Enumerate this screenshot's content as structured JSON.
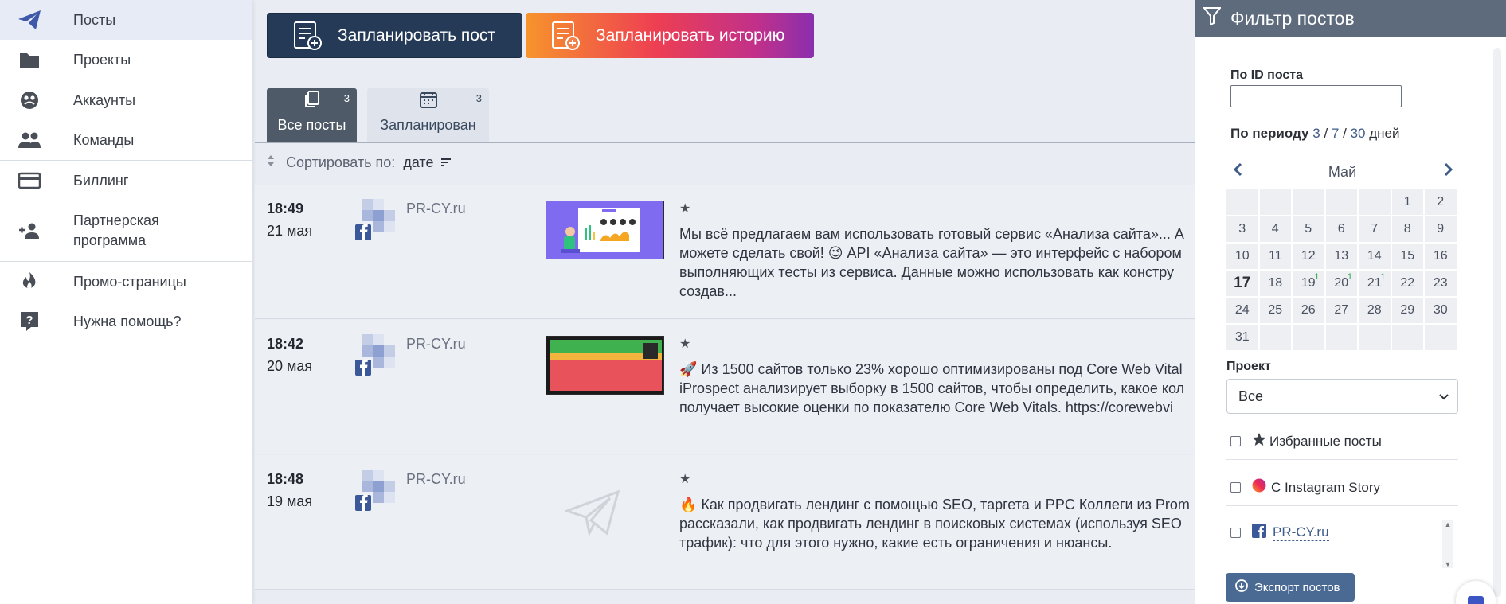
{
  "sidebar": {
    "items": [
      {
        "label": "Посты",
        "icon": "paper-plane-icon"
      },
      {
        "label": "Проекты",
        "icon": "folder-icon"
      },
      {
        "label": "Аккаунты",
        "icon": "accounts-icon"
      },
      {
        "label": "Команды",
        "icon": "team-icon"
      },
      {
        "label": "Биллинг",
        "icon": "credit-card-icon"
      },
      {
        "label": "Партнерская\nпрограмма",
        "icon": "partner-icon"
      },
      {
        "label": "Промо-страницы",
        "icon": "fire-icon"
      },
      {
        "label": "Нужна помощь?",
        "icon": "help-icon"
      }
    ]
  },
  "actions": {
    "plan_post": "Запланировать пост",
    "plan_story": "Запланировать историю"
  },
  "tabs": [
    {
      "label": "Все посты",
      "count": "3"
    },
    {
      "label": "Запланирован",
      "count": "3"
    }
  ],
  "sort": {
    "label": "Сортировать по:",
    "value": "дате"
  },
  "posts": [
    {
      "time": "18:49",
      "date": "21 мая",
      "account": "PR-CY.ru",
      "star": "★",
      "lines": [
        "Мы всё предлагаем вам использовать готовый сервис «Анализа сайта»... А",
        "можете сделать свой! 😉 API «Анализа сайта» — это интерфейс с набором",
        "выполняющих тесты из сервиса. Данные можно использовать как констру",
        "создав..."
      ]
    },
    {
      "time": "18:42",
      "date": "20 мая",
      "account": "PR-CY.ru",
      "star": "★",
      "lines": [
        "🚀 Из 1500 сайтов только 23% хорошо оптимизированы под Core Web Vital",
        "iProspect анализирует выборку в 1500 сайтов, чтобы определить, какое кол",
        "получает высокие оценки по показателю Core Web Vitals. https://corewebvi"
      ]
    },
    {
      "time": "18:48",
      "date": "19 мая",
      "account": "PR-CY.ru",
      "star": "★",
      "lines": [
        "🔥 Как продвигать лендинг с помощью SEO, таргета и PPC Коллеги из Prom",
        "рассказали, как продвигать лендинг в поисковых системах (используя SEO",
        "трафик): что для этого нужно, какие есть ограничения и нюансы."
      ]
    }
  ],
  "filter": {
    "title": "Фильтр постов",
    "by_id_label": "По ID поста",
    "by_id_value": "",
    "period_label": "По периоду",
    "period_3": "3",
    "period_7": "7",
    "period_30": "30",
    "period_sep": "/",
    "period_days": "дней",
    "calendar": {
      "month": "Май",
      "today": "17",
      "cells": [
        "",
        "",
        "",
        "",
        "",
        "1",
        "2",
        "3",
        "4",
        "5",
        "6",
        "7",
        "8",
        "9",
        "10",
        "11",
        "12",
        "13",
        "14",
        "15",
        "16",
        "17",
        "18",
        "19",
        "20",
        "21",
        "22",
        "23",
        "24",
        "25",
        "26",
        "27",
        "28",
        "29",
        "30",
        "31",
        "",
        "",
        "",
        "",
        "",
        ""
      ],
      "badges": {
        "19": "1",
        "20": "1",
        "21": "1"
      }
    },
    "project_label": "Проект",
    "project_value": "Все",
    "favorites_label": "Избранные посты",
    "story_label": "С Instagram Story",
    "account_label": "PR-CY.ru",
    "export_label": "Экспорт постов"
  },
  "colors": {
    "accent": "#3f58a8",
    "primary_button": "#253a56",
    "filter_header": "#5e6b7c",
    "link": "#3e5c8a",
    "badge": "#2ea44f"
  }
}
